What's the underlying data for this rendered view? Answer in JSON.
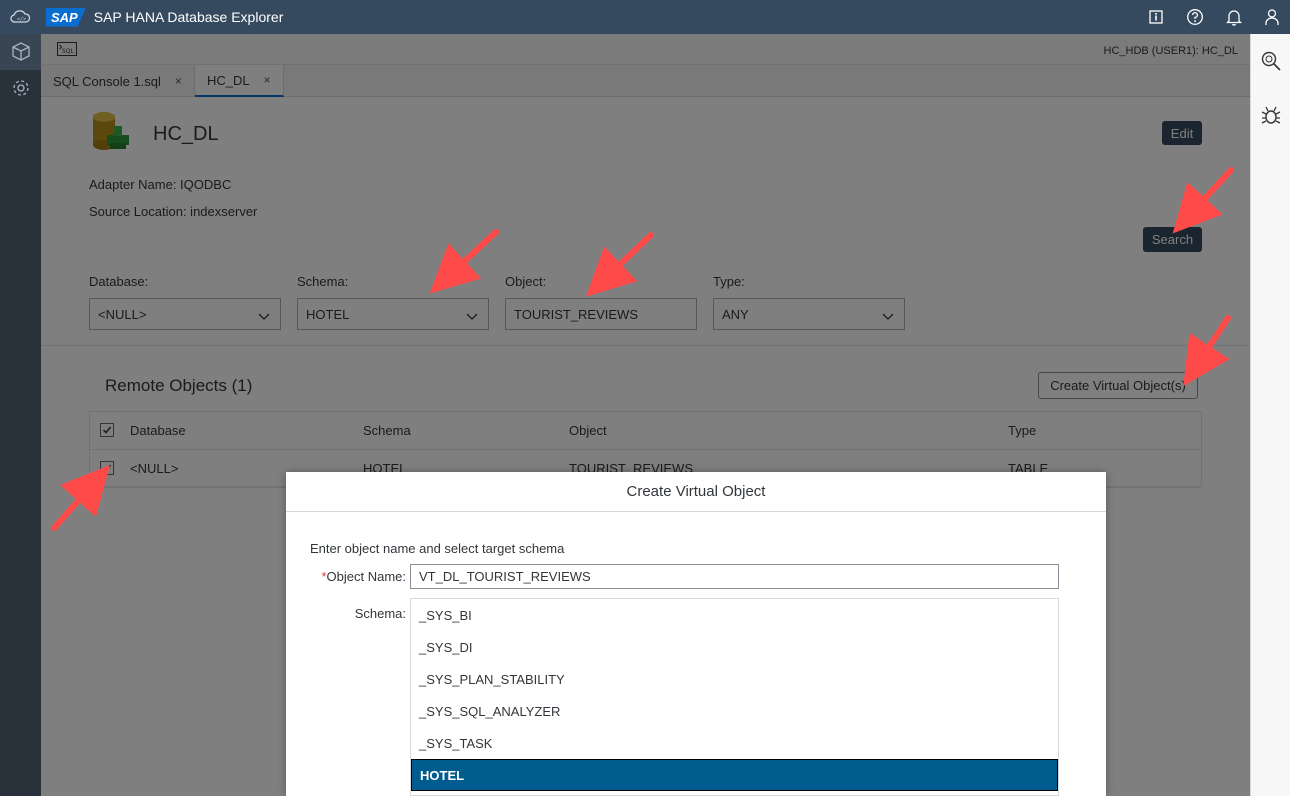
{
  "shell": {
    "logo": "SAP",
    "title": "SAP HANA Database Explorer"
  },
  "toolbar": {
    "connection": "HC_HDB (USER1): HC_DL"
  },
  "tabs": [
    {
      "label": "SQL Console 1.sql",
      "close": "×"
    },
    {
      "label": "HC_DL",
      "close": "×"
    }
  ],
  "header": {
    "name": "HC_DL",
    "edit_label": "Edit",
    "adapter": "Adapter Name: IQODBC",
    "source": "Source Location: indexserver",
    "search_label": "Search"
  },
  "filters": {
    "database": {
      "label": "Database:",
      "value": "<NULL>"
    },
    "schema": {
      "label": "Schema:",
      "value": "HOTEL"
    },
    "object": {
      "label": "Object:",
      "value": "TOURIST_REVIEWS"
    },
    "type": {
      "label": "Type:",
      "value": "ANY"
    }
  },
  "remote": {
    "title": "Remote Objects (1)",
    "create_label": "Create Virtual Object(s)",
    "columns": [
      "Database",
      "Schema",
      "Object",
      "Type"
    ],
    "rows": [
      {
        "database": "<NULL>",
        "schema": "HOTEL",
        "object": "TOURIST_REVIEWS",
        "type": "TABLE",
        "checked": true
      }
    ]
  },
  "dialog": {
    "title": "Create Virtual Object",
    "instruction": "Enter object name and select target schema",
    "object_name_label": "Object Name:",
    "required_mark": "*",
    "object_name_value": "VT_DL_TOURIST_REVIEWS",
    "schema_label": "Schema:",
    "schemas": [
      "_SYS_BI",
      "_SYS_DI",
      "_SYS_PLAN_STABILITY",
      "_SYS_SQL_ANALYZER",
      "_SYS_TASK",
      "HOTEL"
    ],
    "selected_schema": "HOTEL"
  },
  "colors": {
    "shell": "#354a5f",
    "accent": "#0a6ed1",
    "selected": "#005b8f",
    "annotation_arrow": "#ff4a4a"
  },
  "icons": [
    "cloud-icon",
    "info-icon",
    "help-icon",
    "bell-icon",
    "user-icon",
    "database-explorer-icon",
    "settings-icon",
    "sql-icon",
    "search-tool-icon",
    "debug-icon",
    "database-icon",
    "chevron-down-icon",
    "check-icon",
    "arrow-annotation"
  ]
}
